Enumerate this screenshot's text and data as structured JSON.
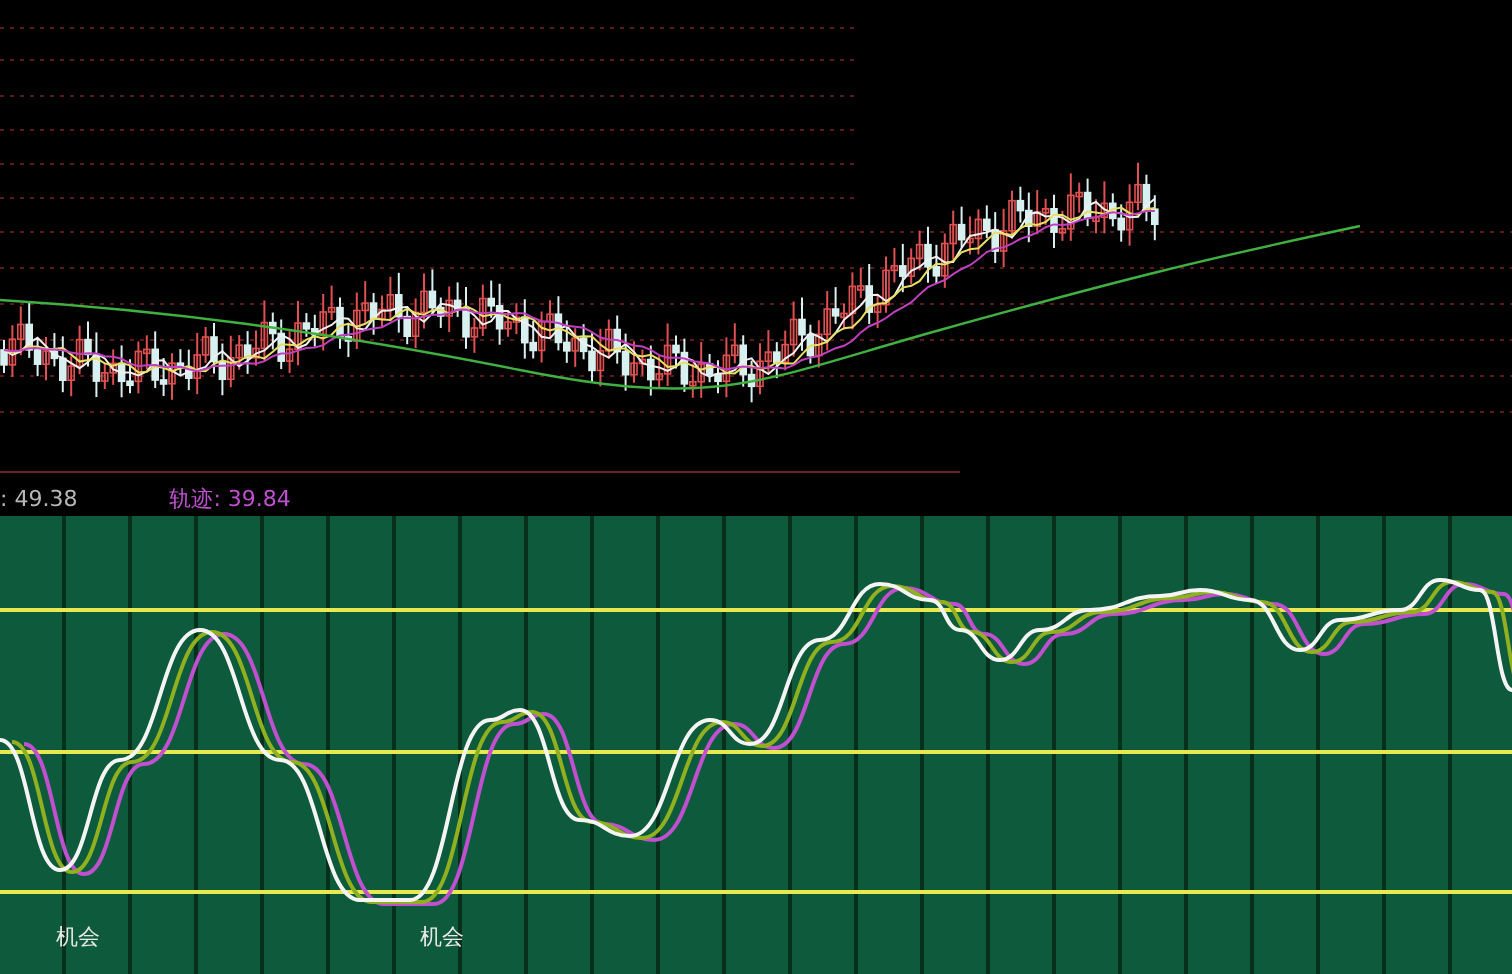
{
  "indicator_bar": {
    "reading": ": 49.38",
    "track_label": "轨迹: 39.84"
  },
  "oscillator_panel": {
    "markers": [
      {
        "label": "机会"
      },
      {
        "label": "机会"
      }
    ]
  }
}
